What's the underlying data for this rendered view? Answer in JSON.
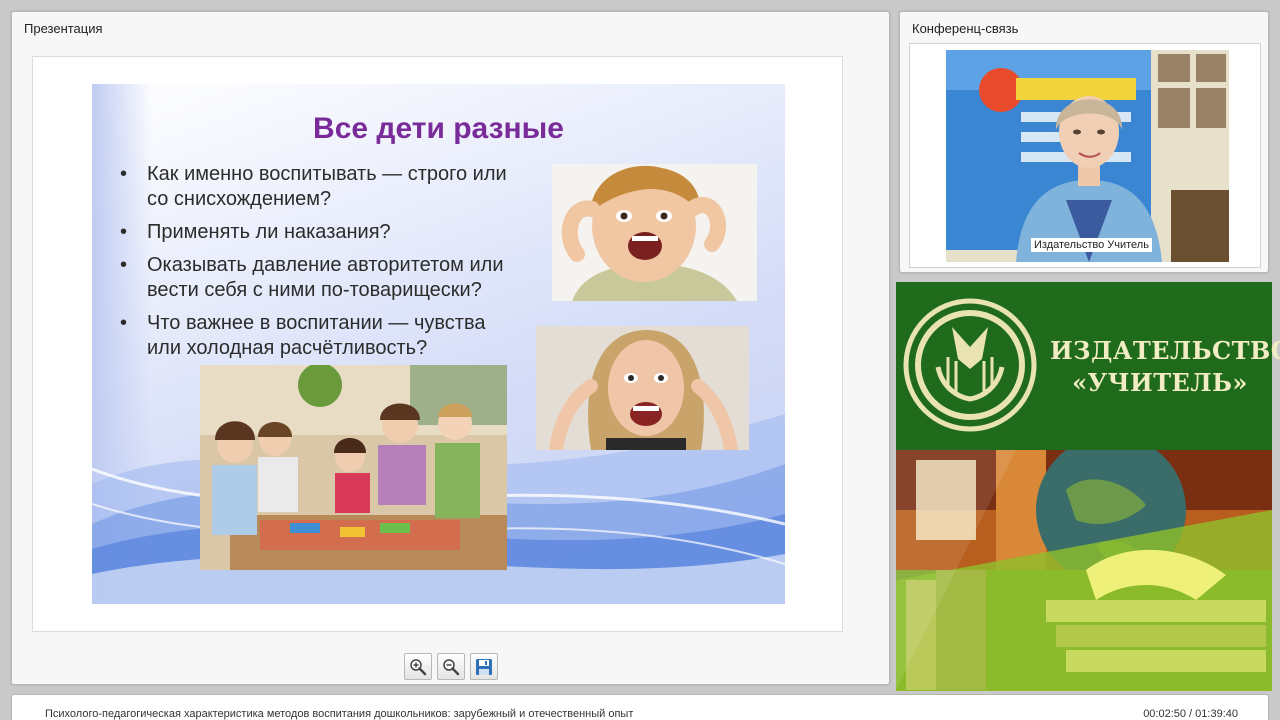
{
  "presentation": {
    "panel_title": "Презентация",
    "slide": {
      "title": "Все дети разные",
      "bullets": [
        "Как именно воспитывать — строго или со снисхождением?",
        "Применять ли наказания?",
        "Оказывать давление авторитетом или вести себя с ними по-товарищески?",
        "Что важнее в воспитании — чувства или холодная расчётливость?"
      ],
      "title_color": "#7a2b9a"
    },
    "toolbar": [
      {
        "name": "zoom-in-button",
        "icon": "zoom-in-icon"
      },
      {
        "name": "zoom-out-button",
        "icon": "zoom-out-icon"
      },
      {
        "name": "save-button",
        "icon": "save-icon"
      }
    ]
  },
  "conference": {
    "panel_title": "Конференц-связь",
    "speaker_caption": "Издательство Учитель"
  },
  "banner": {
    "line1": "ИЗДАТЕЛЬСТВО",
    "line2": "«УЧИТЕЛЬ»",
    "colors": {
      "green": "#1f6b1b",
      "cream": "#f1ecc4"
    }
  },
  "footer": {
    "title": "Психолого-педагогическая характеристика методов воспитания дошкольников: зарубежный и отечественный опыт",
    "time": "00:02:50 / 01:39:40"
  }
}
